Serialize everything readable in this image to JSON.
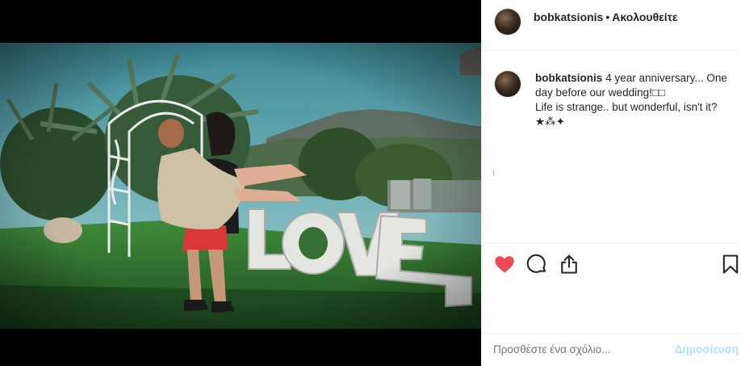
{
  "post": {
    "author": "bobkatsionis",
    "follow_status": "Ακολουθείτε",
    "separator": "•",
    "caption_line1": "4 year anniversary... One day before our wedding!□□",
    "caption_line2": "Life is strange.. but wonderful, isn't it?",
    "caption_emoji": "★⁂✦",
    "image_text": "LOVE"
  },
  "comment": {
    "placeholder": "Προσθέστε ένα σχόλιο...",
    "post_label": "Δημοσίευση"
  },
  "colors": {
    "like": "#ed4956",
    "post_disabled": "#b2dffc"
  },
  "icons": {
    "like": "heart-icon",
    "comment": "comment-icon",
    "share": "share-icon",
    "save": "bookmark-icon"
  }
}
